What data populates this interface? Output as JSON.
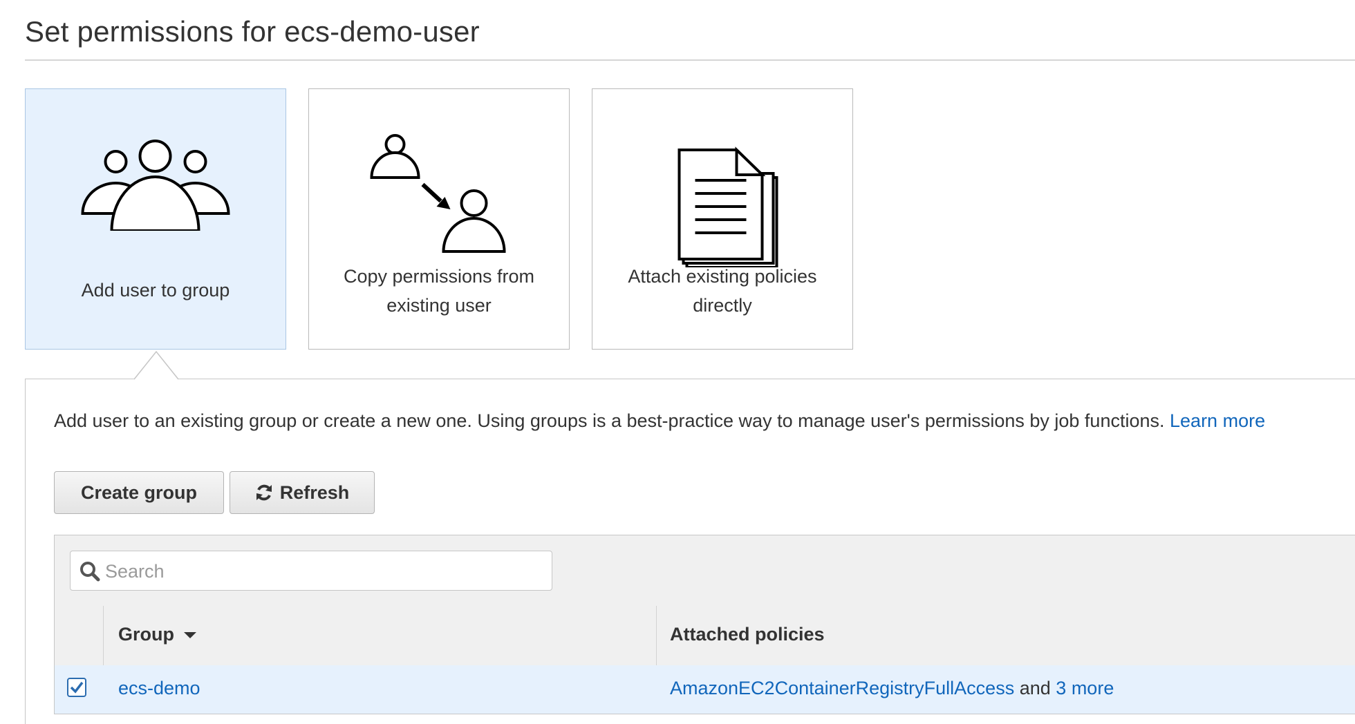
{
  "page": {
    "title": "Set permissions for ecs-demo-user"
  },
  "options": [
    {
      "label_line1": "Add user to group",
      "label_line2": "",
      "icon": "group-icon",
      "selected": true
    },
    {
      "label_line1": "Copy permissions from",
      "label_line2": "existing user",
      "icon": "copy-user-icon",
      "selected": false
    },
    {
      "label_line1": "Attach existing policies",
      "label_line2": "directly",
      "icon": "document-icon",
      "selected": false
    }
  ],
  "panel": {
    "description": "Add user to an existing group or create a new one. Using groups is a best-practice way to manage user's permissions by job functions.",
    "learn_more": "Learn more"
  },
  "toolbar": {
    "create_group_label": "Create group",
    "refresh_label": "Refresh"
  },
  "search": {
    "placeholder": "Search",
    "value": ""
  },
  "table": {
    "columns": [
      "Group",
      "Attached policies"
    ],
    "rows": [
      {
        "checked": true,
        "group": "ecs-demo",
        "policy": "AmazonEC2ContainerRegistryFullAccess",
        "and_text": "and",
        "more": "3 more"
      }
    ]
  },
  "colors": {
    "selected_bg": "#e6f1fd",
    "link": "#1166bb",
    "button_bg": "#eeeeee"
  }
}
